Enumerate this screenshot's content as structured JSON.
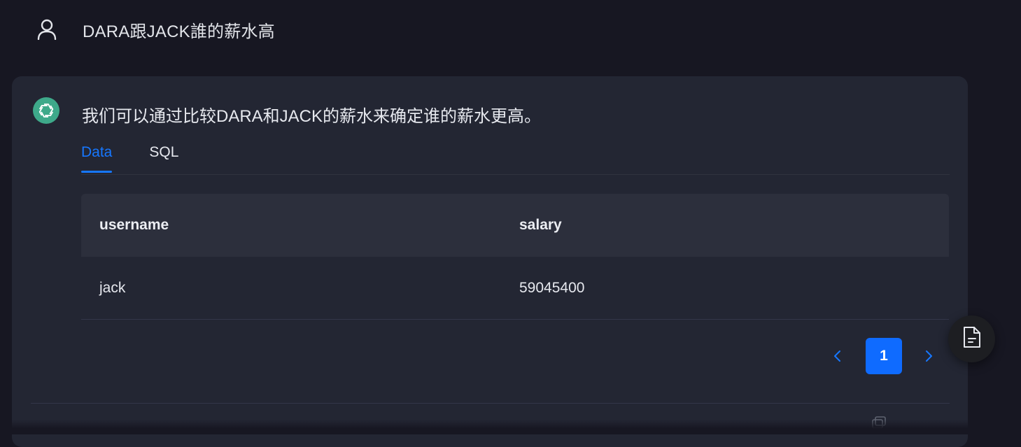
{
  "user": {
    "question": "DARA跟JACK誰的薪水高",
    "icon": "user-icon"
  },
  "answer": {
    "icon": "openai-logo-icon",
    "text": "我们可以通过比较DARA和JACK的薪水来确定谁的薪水更高。"
  },
  "tabs": [
    {
      "label": "Data",
      "active": true
    },
    {
      "label": "SQL",
      "active": false
    }
  ],
  "table": {
    "headers": [
      "username",
      "salary"
    ],
    "rows": [
      [
        "jack",
        "59045400"
      ]
    ]
  },
  "pagination": {
    "current_page": "1",
    "prev_icon": "chevron-left-icon",
    "next_icon": "chevron-right-icon"
  },
  "fab": {
    "icon": "document-icon"
  },
  "colors": {
    "background": "#171722",
    "card": "#232633",
    "accent": "#1677ff",
    "ai_logo": "#3ea98a"
  }
}
